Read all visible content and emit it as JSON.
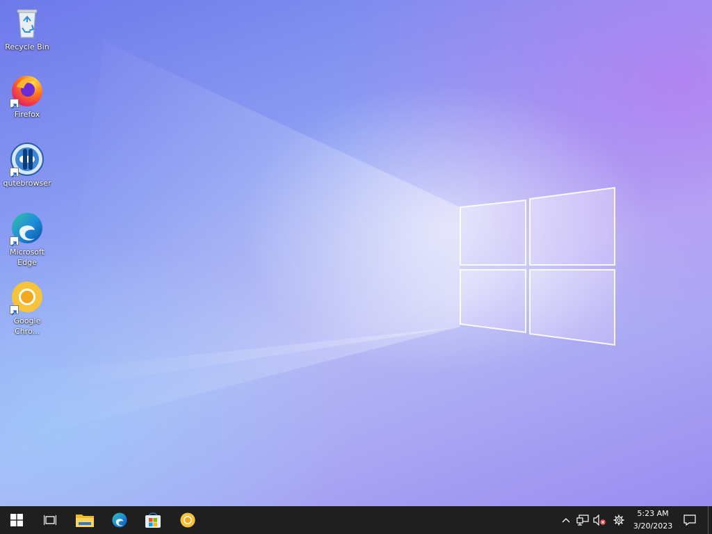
{
  "desktop": {
    "icons": [
      {
        "label": "Recycle Bin",
        "icon": "recycle-bin-icon"
      },
      {
        "label": "Firefox",
        "icon": "firefox-icon"
      },
      {
        "label": "qutebrowser",
        "icon": "qutebrowser-icon"
      },
      {
        "label": "Microsoft Edge",
        "icon": "edge-icon"
      },
      {
        "label": "Google Chro...",
        "icon": "chrome-icon"
      }
    ]
  },
  "taskbar": {
    "start": {
      "icon": "windows-start-icon"
    },
    "task_view": {
      "icon": "task-view-icon"
    },
    "pinned": [
      {
        "icon": "file-explorer-icon"
      },
      {
        "icon": "edge-icon"
      },
      {
        "icon": "microsoft-store-icon"
      },
      {
        "icon": "chrome-icon"
      }
    ],
    "tray": {
      "icons": [
        "show-hidden-icons-chevron-icon",
        "network-icon",
        "volume-muted-icon",
        "settings-gear-icon"
      ],
      "time": "5:23 AM",
      "date": "3/20/2023",
      "notification_icon": "action-center-icon"
    }
  },
  "colors": {
    "taskbar": "#1f1f1f",
    "wallpaper_primary": "#7b86ee",
    "wallpaper_accent": "#b478f0"
  }
}
